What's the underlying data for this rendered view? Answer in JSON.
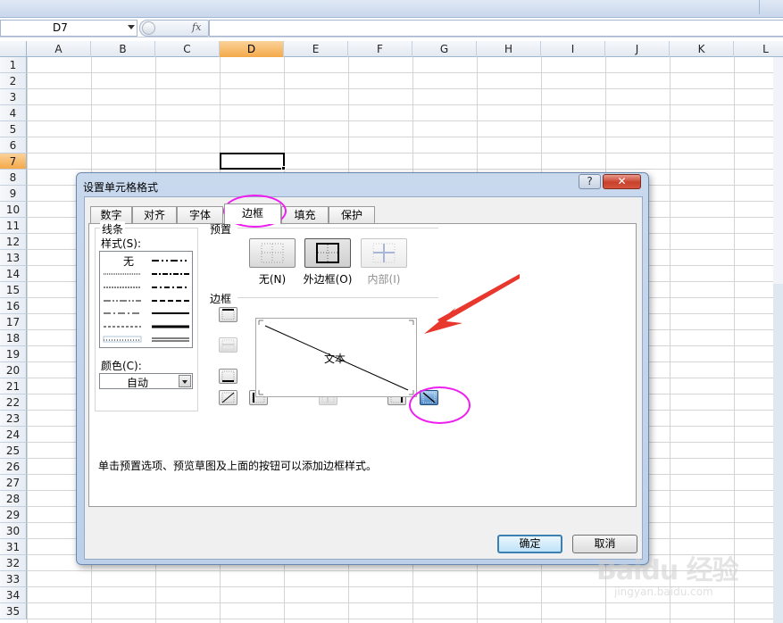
{
  "formula_bar": {
    "name_box": "D7",
    "fx_label": "fx",
    "formula_value": ""
  },
  "sheet": {
    "columns": [
      "A",
      "B",
      "C",
      "D",
      "E",
      "F",
      "G",
      "H",
      "I",
      "J",
      "K",
      "L"
    ],
    "active_column": "D",
    "rows": [
      "1",
      "2",
      "3",
      "4",
      "5",
      "6",
      "7",
      "8",
      "9",
      "10",
      "11",
      "12",
      "13",
      "14",
      "15",
      "16",
      "17",
      "18",
      "19",
      "20",
      "21",
      "22",
      "23",
      "24",
      "25",
      "26",
      "27",
      "28",
      "29",
      "30",
      "31",
      "32",
      "33",
      "34",
      "35"
    ],
    "active_row": "7"
  },
  "dialog": {
    "title": "设置单元格格式",
    "help_label": "?",
    "close_label": "✕",
    "tabs": [
      {
        "label": "数字"
      },
      {
        "label": "对齐"
      },
      {
        "label": "字体"
      },
      {
        "label": "边框"
      },
      {
        "label": "填充"
      },
      {
        "label": "保护"
      }
    ],
    "selected_tab": "边框",
    "line_group": {
      "label": "线条",
      "style_label": "样式(S):",
      "none_label": "无",
      "color_label": "颜色(C):",
      "color_value": "自动"
    },
    "presets": {
      "label": "预置",
      "items": [
        {
          "label": "无(N)",
          "state": "normal"
        },
        {
          "label": "外边框(O)",
          "state": "pressed"
        },
        {
          "label": "内部(I)",
          "state": "disabled"
        }
      ]
    },
    "border": {
      "label": "边框",
      "preview_text": "文本"
    },
    "hint": "单击预置选项、预览草图及上面的按钮可以添加边框样式。",
    "ok_label": "确定",
    "cancel_label": "取消"
  },
  "watermark": {
    "brand": "Baidu 经验",
    "url": "jingyan.baidu.com"
  },
  "colors": {
    "annotation": "#ee1ef0",
    "arrow": "#e8372d",
    "active_header": "#f4a94a"
  }
}
